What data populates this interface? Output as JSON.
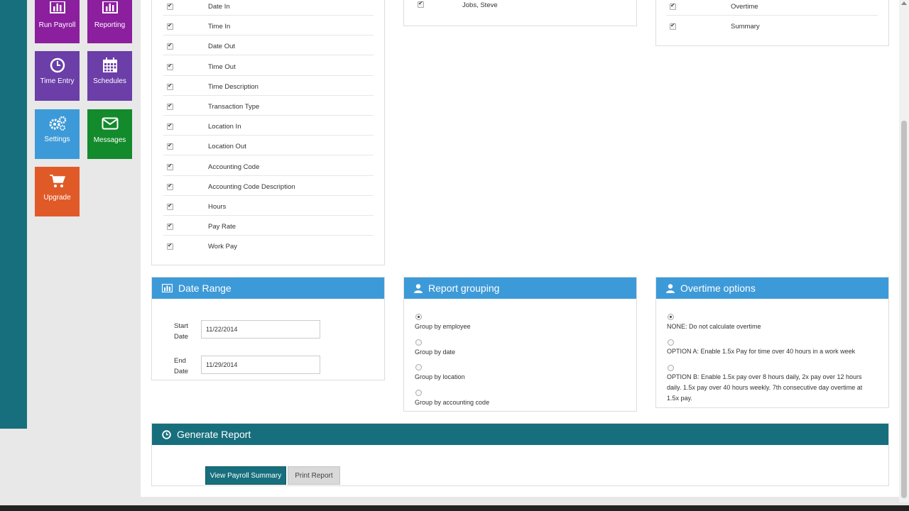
{
  "nav_tiles": [
    {
      "label": "Run Payroll",
      "icon": "bar-chart-icon",
      "color": "#8b1f9e"
    },
    {
      "label": "Reporting",
      "icon": "bar-chart-icon",
      "color": "#8b1f9e"
    },
    {
      "label": "Time Entry",
      "icon": "clock-icon",
      "color": "#6b3ea8"
    },
    {
      "label": "Schedules",
      "icon": "calendar-icon",
      "color": "#6b3ea8"
    },
    {
      "label": "Settings",
      "icon": "gears-icon",
      "color": "#3d9ad8"
    },
    {
      "label": "Messages",
      "icon": "envelope-icon",
      "color": "#138a2c"
    },
    {
      "label": "Upgrade",
      "icon": "cart-icon",
      "color": "#e05a28"
    }
  ],
  "columns": {
    "items": [
      "Date In",
      "Time In",
      "Date Out",
      "Time Out",
      "Time Description",
      "Transaction Type",
      "Location In",
      "Location Out",
      "Accounting Code",
      "Accounting Code Description",
      "Hours",
      "Pay Rate",
      "Work Pay"
    ]
  },
  "employees": {
    "items": [
      "Jobs, Steve"
    ]
  },
  "report_types": {
    "items": [
      "Overtime",
      "Summary"
    ]
  },
  "date_range": {
    "title": "Date Range",
    "start_label_1": "Start",
    "start_label_2": "Date",
    "start_value": "11/22/2014",
    "end_label_1": "End",
    "end_label_2": "Date",
    "end_value": "11/29/2014"
  },
  "grouping": {
    "title": "Report grouping",
    "options": [
      "Group by employee",
      "Group by date",
      "Group by location",
      "Group by accounting code"
    ],
    "selected": 0
  },
  "overtime": {
    "title": "Overtime options",
    "option_none": "NONE: Do not calculate overtime",
    "option_a": "OPTION A: Enable 1.5x Pay for time over 40 hours in a work week",
    "option_b_line1": "OPTION B: Enable 1.5x pay over 8 hours daily, 2x pay over 12 hours",
    "option_b_line2": "daily. 1.5x pay over 40 hours weekly. 7th consecutive day overtime at",
    "option_b_line3": "1.5x pay.",
    "selected": 0
  },
  "generate": {
    "title": "Generate Report",
    "view_label": "View Payroll Summary",
    "print_label": "Print Report"
  },
  "colors": {
    "panel_head": "#3d9ad8",
    "teal": "#176f7d",
    "view_button": "#176f7d"
  }
}
